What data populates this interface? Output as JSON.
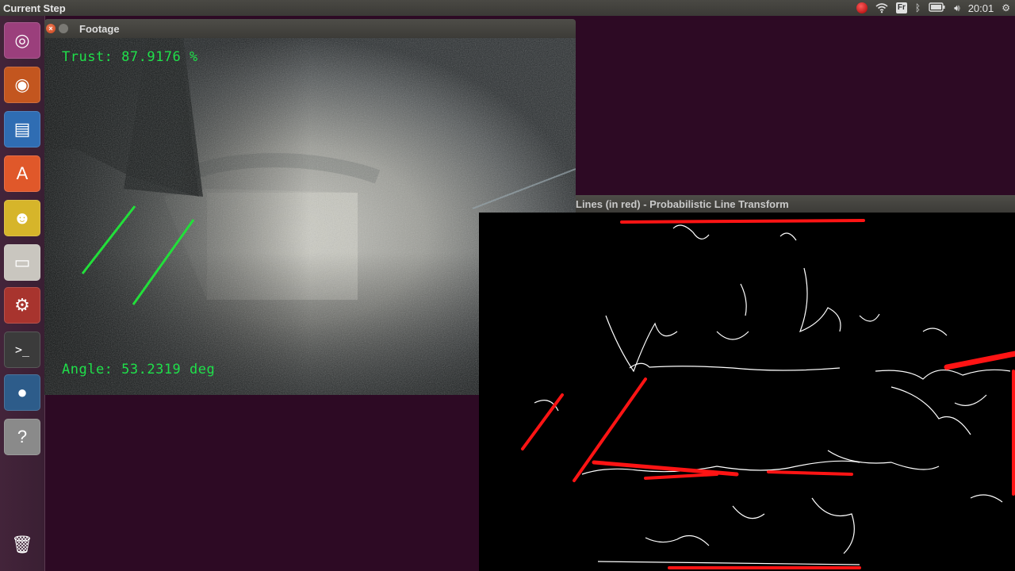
{
  "topbar": {
    "app_title": "Current Step",
    "keyboard_layout": "Fr",
    "clock": "20:01"
  },
  "launcher": {
    "items": [
      {
        "name": "dash-home",
        "icon": "ubuntu-logo-icon",
        "glyph": "◎",
        "bg": "#9b3f7c"
      },
      {
        "name": "firefox",
        "icon": "firefox-icon",
        "glyph": "◉",
        "bg": "#c3561f"
      },
      {
        "name": "libreoffice-writer",
        "icon": "document-icon",
        "glyph": "▤",
        "bg": "#2f6db3"
      },
      {
        "name": "ubuntu-software",
        "icon": "software-center-icon",
        "glyph": "A",
        "bg": "#e0582a"
      },
      {
        "name": "cheese",
        "icon": "cheese-icon",
        "glyph": "☻",
        "bg": "#d6b52a"
      },
      {
        "name": "files-archive",
        "icon": "archive-icon",
        "glyph": "▭",
        "bg": "#c9c6bf"
      },
      {
        "name": "system-settings",
        "icon": "settings-gear-icon",
        "glyph": "⚙",
        "bg": "#a8342e"
      },
      {
        "name": "terminal",
        "icon": "terminal-icon",
        "glyph": ">_",
        "bg": "#3b3b3b"
      },
      {
        "name": "browser-globe",
        "icon": "globe-icon",
        "glyph": "●",
        "bg": "#2d5c8a"
      },
      {
        "name": "help",
        "icon": "help-icon",
        "glyph": "?",
        "bg": "#8a8a8a"
      }
    ],
    "trash": {
      "icon": "trash-icon",
      "glyph": "🗑"
    }
  },
  "footage_window": {
    "title": "Footage",
    "trust_text": "Trust: 87.9176 %",
    "angle_text": "Angle: 53.2319 deg",
    "overlay_color": "#1fe04a"
  },
  "lines_window": {
    "title": "Lines (in red) - Probabilistic Line Transform",
    "line_color": "#ff1414",
    "edge_color": "#ffffff"
  }
}
